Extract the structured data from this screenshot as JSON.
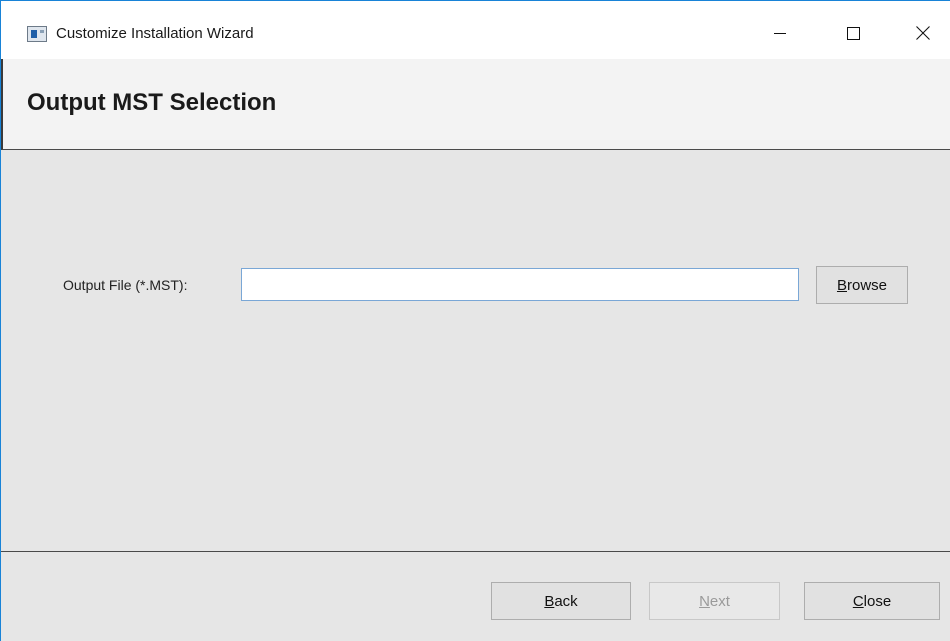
{
  "window": {
    "title": "Customize Installation Wizard",
    "controls": {
      "minimize": "minimize-icon",
      "maximize": "maximize-icon",
      "close": "close-icon"
    }
  },
  "header": {
    "title": "Output MST Selection"
  },
  "form": {
    "output_label": "Output File (*.MST):",
    "output_value": "",
    "browse": {
      "mnemonic": "B",
      "rest": "rowse"
    }
  },
  "footer": {
    "back": {
      "mnemonic": "B",
      "rest": "ack"
    },
    "next": {
      "mnemonic": "N",
      "rest": "ext",
      "enabled": false
    },
    "close": {
      "mnemonic": "C",
      "rest": "lose"
    }
  },
  "colors": {
    "accent_border": "#1883d7",
    "input_border": "#7aa7d6",
    "panel_bg": "#e6e6e6",
    "header_bg": "#f3f3f3",
    "disabled_text": "#9a9a9a"
  }
}
